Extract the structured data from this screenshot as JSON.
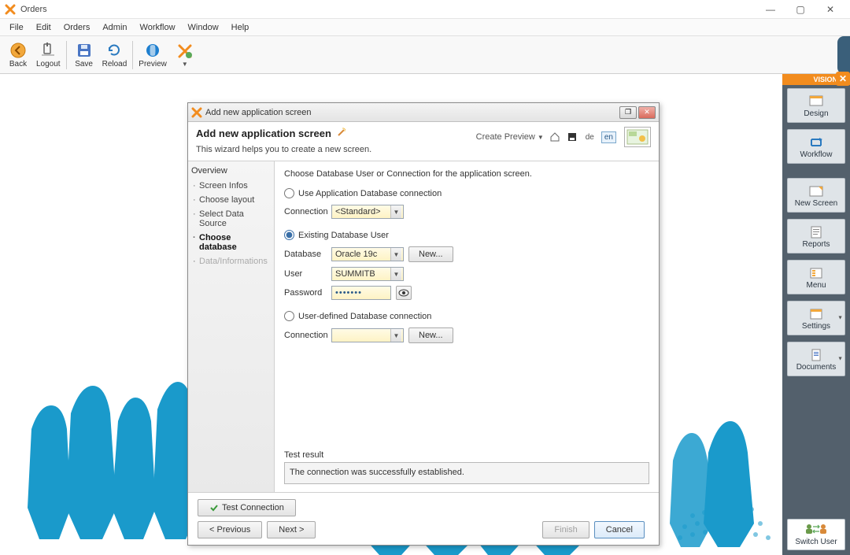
{
  "window": {
    "title": "Orders"
  },
  "menu": [
    "File",
    "Edit",
    "Orders",
    "Admin",
    "Workflow",
    "Window",
    "Help"
  ],
  "toolbar": {
    "back": "Back",
    "logout": "Logout",
    "save": "Save",
    "reload": "Reload",
    "preview": "Preview"
  },
  "rightpanel": {
    "tag": "VISION",
    "design": "Design",
    "workflow": "Workflow",
    "newscreen": "New Screen",
    "reports": "Reports",
    "menu": "Menu",
    "settings": "Settings",
    "documents": "Documents",
    "switchuser": "Switch User"
  },
  "dialog": {
    "title": "Add new application screen",
    "heading": "Add new application screen",
    "subheading": "This wizard helps you to create a new screen.",
    "createpreview": "Create Preview",
    "lang_de": "de",
    "lang_en": "en",
    "nav": {
      "overview": "Overview",
      "screeninfos": "Screen Infos",
      "chooselayout": "Choose layout",
      "selectds": "Select Data Source",
      "choosedb": "Choose database",
      "datainfo": "Data/Informations"
    },
    "content": {
      "intro": "Choose Database User or Connection for the application screen.",
      "opt_appconn": "Use Application Database connection",
      "lbl_connection": "Connection",
      "val_connection": "<Standard>",
      "opt_existing": "Existing Database User",
      "lbl_database": "Database",
      "val_database": "Oracle 19c",
      "btn_new": "New...",
      "lbl_user": "User",
      "val_user": "SUMMITB",
      "lbl_password": "Password",
      "val_password": "•••••••",
      "opt_userdef": "User-defined Database connection",
      "lbl_connection2": "Connection",
      "val_connection2": "",
      "btn_new2": "New...",
      "testresult_label": "Test result",
      "testresult_text": "The connection was successfully established."
    },
    "buttons": {
      "testconn": "Test Connection",
      "previous": "< Previous",
      "next": "Next >",
      "finish": "Finish",
      "cancel": "Cancel"
    }
  }
}
